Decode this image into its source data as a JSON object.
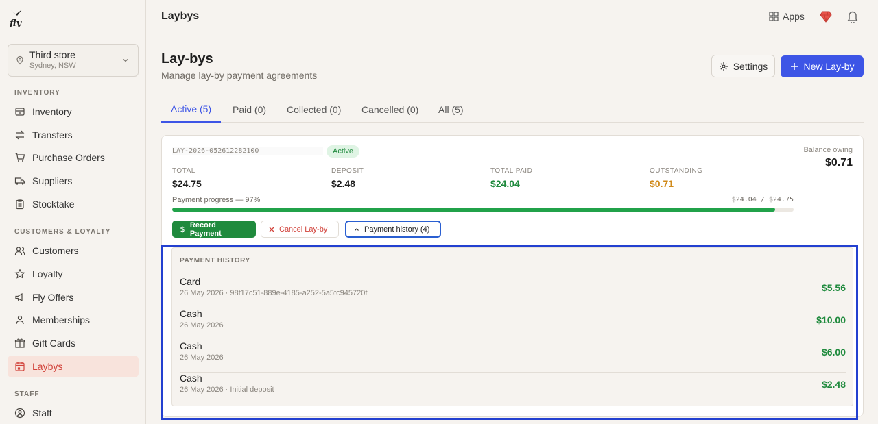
{
  "app": {
    "logo_text": "fly"
  },
  "store": {
    "name": "Third store",
    "location": "Sydney, NSW"
  },
  "sidebar": {
    "sections": [
      {
        "label": "INVENTORY"
      },
      {
        "label": "CUSTOMERS & LOYALTY"
      },
      {
        "label": "STAFF"
      }
    ],
    "items": [
      {
        "label": "Inventory",
        "icon": "box-icon"
      },
      {
        "label": "Transfers",
        "icon": "transfer-icon"
      },
      {
        "label": "Purchase Orders",
        "icon": "cart-icon"
      },
      {
        "label": "Suppliers",
        "icon": "truck-icon"
      },
      {
        "label": "Stocktake",
        "icon": "clipboard-icon"
      },
      {
        "label": "Customers",
        "icon": "users-icon"
      },
      {
        "label": "Loyalty",
        "icon": "star-icon"
      },
      {
        "label": "Fly Offers",
        "icon": "megaphone-icon"
      },
      {
        "label": "Memberships",
        "icon": "members-icon"
      },
      {
        "label": "Gift Cards",
        "icon": "gift-icon"
      },
      {
        "label": "Laybys",
        "icon": "calendar-icon",
        "active": true
      },
      {
        "label": "Staff",
        "icon": "staff-icon"
      }
    ]
  },
  "header": {
    "title": "Laybys",
    "apps_label": "Apps"
  },
  "page": {
    "title": "Lay-bys",
    "subtitle": "Manage lay-by payment agreements",
    "settings_label": "Settings",
    "new_label": "New Lay-by"
  },
  "tabs": [
    {
      "label": "Active (5)",
      "active": true
    },
    {
      "label": "Paid (0)"
    },
    {
      "label": "Collected (0)"
    },
    {
      "label": "Cancelled (0)"
    },
    {
      "label": "All (5)"
    }
  ],
  "layby": {
    "ref": "LAY-2026-052612282100",
    "status": "Active",
    "balance_label": "Balance owing",
    "balance": "$0.71",
    "stats": [
      {
        "label": "TOTAL",
        "value": "$24.75",
        "tone": "normal"
      },
      {
        "label": "DEPOSIT",
        "value": "$2.48",
        "tone": "normal"
      },
      {
        "label": "TOTAL PAID",
        "value": "$24.04",
        "tone": "green"
      },
      {
        "label": "OUTSTANDING",
        "value": "$0.71",
        "tone": "orange"
      }
    ],
    "progress_label": "Payment progress — 97%",
    "progress_amount": "$24.04 / $24.75",
    "progress_fraction": 0.97,
    "actions": {
      "record": "Record Payment",
      "cancel": "Cancel Lay-by",
      "history": "Payment history (4)"
    }
  },
  "history": {
    "title": "PAYMENT HISTORY",
    "rows": [
      {
        "method": "Card",
        "meta": "26 May 2026 · 98f17c51-889e-4185-a252-5a5fc945720f",
        "amount": "$5.56"
      },
      {
        "method": "Cash",
        "meta": "26 May 2026",
        "amount": "$10.00"
      },
      {
        "method": "Cash",
        "meta": "26 May 2026",
        "amount": "$6.00"
      },
      {
        "method": "Cash",
        "meta": "26 May 2026 · Initial deposit",
        "amount": "$2.48"
      }
    ]
  },
  "colors": {
    "accent": "#3d55e6",
    "success": "#1f8a3d",
    "warning": "#d08a1a",
    "danger": "#d2443c"
  }
}
